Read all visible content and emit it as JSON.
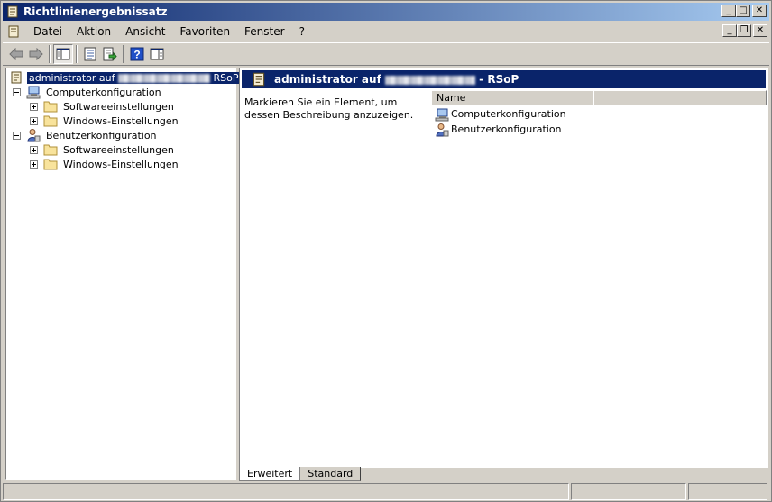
{
  "window": {
    "title": "Richtlinienergebnissatz",
    "controls": {
      "minimize": "_",
      "maximize": "□",
      "close": "✕"
    }
  },
  "menubar": {
    "items": [
      "Datei",
      "Aktion",
      "Ansicht",
      "Favoriten",
      "Fenster",
      "?"
    ],
    "mdi_controls": {
      "minimize": "_",
      "restore": "❐",
      "close": "✕"
    }
  },
  "toolbar": {
    "buttons": [
      "back-arrow-icon",
      "forward-arrow-icon",
      "show-hide-tree-icon",
      "properties-icon",
      "export-list-icon",
      "help-icon",
      "show-hide-action-pane-icon"
    ]
  },
  "tree": {
    "root": {
      "label_prefix": "administrator auf",
      "label_suffix": "RSoP"
    },
    "computer": {
      "label": "Computerkonfiguration",
      "children": [
        "Softwareeinstellungen",
        "Windows-Einstellungen"
      ]
    },
    "user": {
      "label": "Benutzerkonfiguration",
      "children": [
        "Softwareeinstellungen",
        "Windows-Einstellungen"
      ]
    }
  },
  "details": {
    "header_prefix": "administrator auf",
    "header_suffix": "- RSoP",
    "description": "Markieren Sie ein Element, um dessen Beschreibung anzuzeigen.",
    "columns": [
      "Name"
    ],
    "items": [
      "Computerkonfiguration",
      "Benutzerkonfiguration"
    ]
  },
  "tabs": [
    "Erweitert",
    "Standard"
  ],
  "colors": {
    "titlebar_start": "#0a246a",
    "titlebar_end": "#a6caf0",
    "selection": "#0a246a",
    "face": "#d4d0c8"
  }
}
